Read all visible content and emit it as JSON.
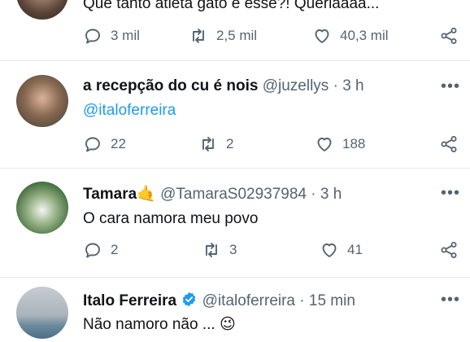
{
  "tweets": [
    {
      "text": "Que tanto atleta gato é esse?! Queriaaaa...",
      "stats": {
        "replies": "3 mil",
        "retweets": "2,5 mil",
        "likes": "40,3 mil"
      }
    },
    {
      "name": "a recepção do cu é nois",
      "handle": "@juzellys",
      "time": "3 h",
      "mention": "@italoferreira",
      "stats": {
        "replies": "22",
        "retweets": "2",
        "likes": "188"
      }
    },
    {
      "name": "Tamara",
      "name_emoji": "🤙",
      "handle": "@TamaraS02937984",
      "time": "3 h",
      "text": "O cara namora meu povo",
      "stats": {
        "replies": "2",
        "retweets": "3",
        "likes": "41"
      }
    },
    {
      "name": "Italo Ferreira",
      "handle": "@italoferreira",
      "time": "15 min",
      "text": "Não namoro não ...",
      "text_emoji": "😉"
    }
  ],
  "separator": "·",
  "menu": "•••",
  "colors": {
    "accent": "#1d9bf0",
    "muted": "#536471",
    "verified": "#1d9bf0"
  }
}
